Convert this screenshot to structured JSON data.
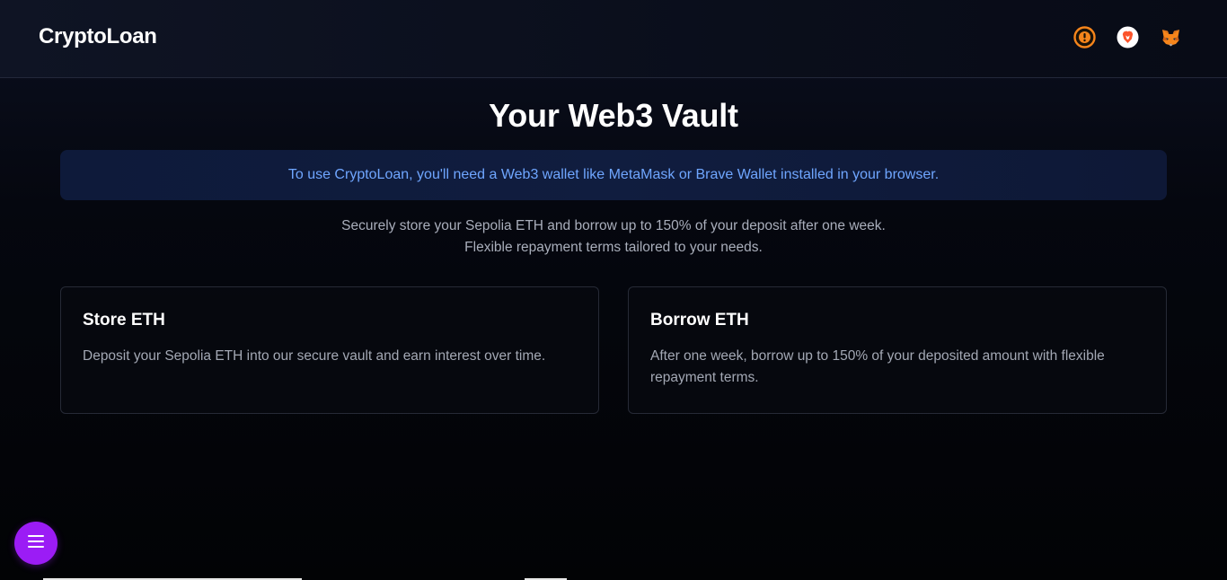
{
  "header": {
    "brand": "CryptoLoan",
    "wallet_icons": [
      "metamask-alert-icon",
      "brave-lion-icon",
      "metamask-fox-icon"
    ]
  },
  "main": {
    "title": "Your Web3 Vault",
    "notice": "To use CryptoLoan, you'll need a Web3 wallet like MetaMask or Brave Wallet installed in your browser.",
    "description_line1": "Securely store your Sepolia ETH and borrow up to 150% of your deposit after one week.",
    "description_line2": "Flexible repayment terms tailored to your needs.",
    "cards": [
      {
        "title": "Store ETH",
        "text": "Deposit your Sepolia ETH into our secure vault and earn interest over time."
      },
      {
        "title": "Borrow ETH",
        "text": "After one week, borrow up to 150% of your deposited amount with flexible repayment terms."
      }
    ]
  },
  "fab": {
    "icon": "menu-icon"
  },
  "colors": {
    "accent_purple": "#9b1cf5",
    "notice_text": "#6fa6ff",
    "brave_orange": "#fb542b",
    "metamask_orange": "#f6851b"
  }
}
